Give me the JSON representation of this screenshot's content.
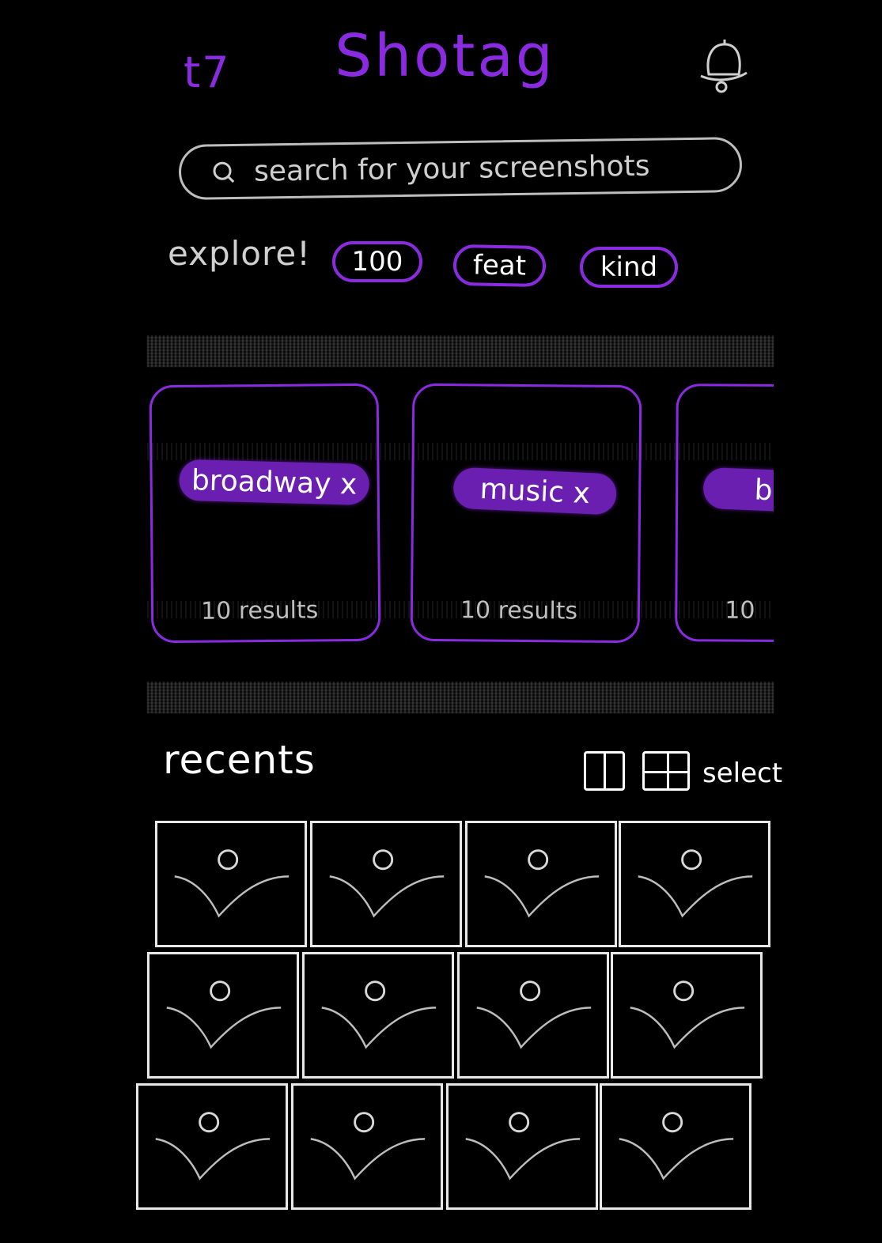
{
  "header": {
    "left_icon_text": "t7",
    "title": "Shotag",
    "bell_icon": "bell-icon"
  },
  "search": {
    "placeholder": "search for your screenshots",
    "icon": "search-icon"
  },
  "explore": {
    "label": "explore!",
    "chips": [
      "100",
      "feat",
      "kind"
    ]
  },
  "collections": [
    {
      "tag": "broadway x",
      "count": "10 results"
    },
    {
      "tag": "music x",
      "count": "10 results"
    },
    {
      "tag": "broa",
      "count": "10"
    }
  ],
  "recents": {
    "title": "recents",
    "view_single_icon": "single-column-view-icon",
    "view_grid_icon": "grid-view-icon",
    "select_label": "select"
  },
  "thumbnails": {
    "rows": 3,
    "columns": 4,
    "icon": "image-placeholder-icon"
  },
  "colors": {
    "background": "#000000",
    "accent": "#8a2be2",
    "chalk": "#e8e8e8"
  }
}
